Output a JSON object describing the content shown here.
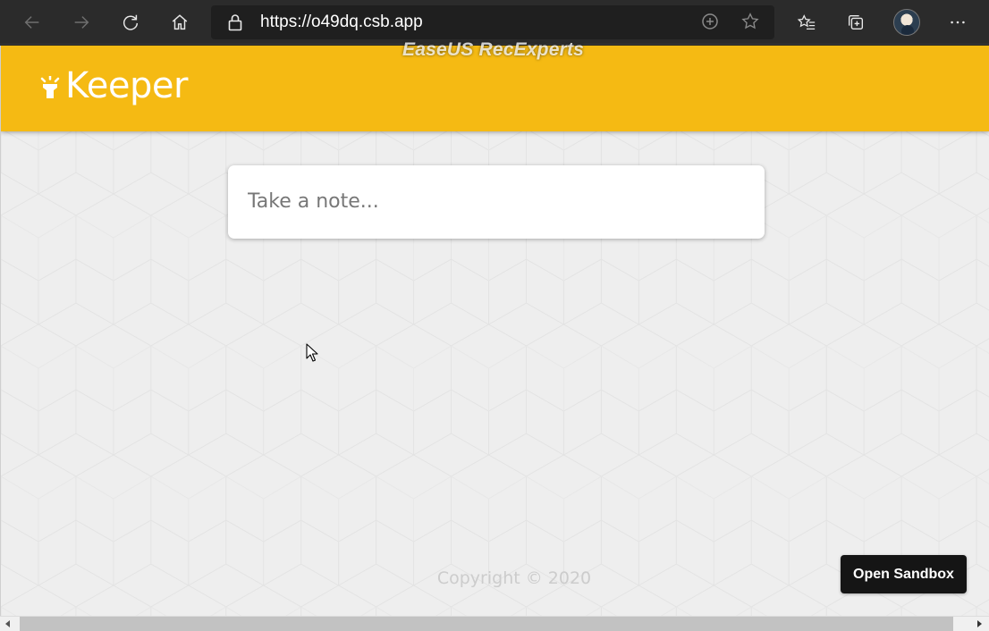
{
  "browser": {
    "url": "https://o49dq.csb.app",
    "icons": {
      "back": "back-arrow-icon",
      "forward": "forward-arrow-icon",
      "refresh": "refresh-icon",
      "home": "home-icon",
      "lock": "lock-icon",
      "add": "add-circle-icon",
      "star": "star-icon",
      "favorites": "favorites-icon",
      "collections": "collections-icon",
      "menu": "more-icon"
    }
  },
  "watermark": "EaseUS RecExperts",
  "app": {
    "title": "Keeper",
    "accent": "#f5ba13",
    "note_placeholder": "Take a note...",
    "footer": "Copyright © 2020"
  },
  "sandbox_button": "Open Sandbox"
}
